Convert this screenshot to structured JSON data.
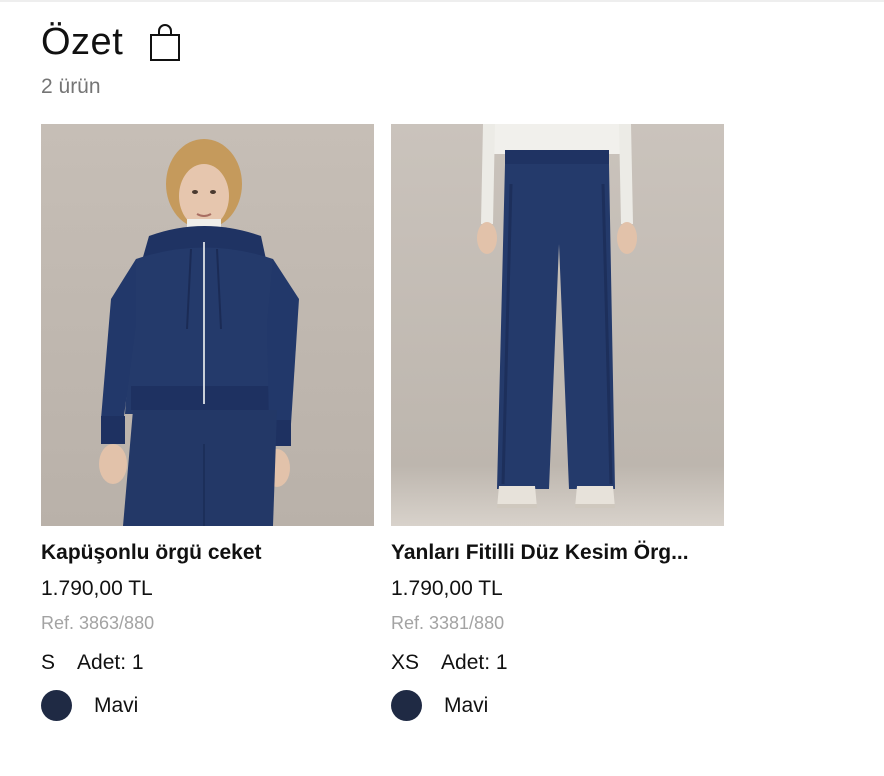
{
  "summary": {
    "title": "Özet",
    "count_label": "2 ürün",
    "icon": "shopping-bag-icon"
  },
  "products": [
    {
      "image_alt": "Kapüşonlu örgü ceket",
      "name": "Kapüşonlu örgü ceket",
      "price": "1.790,00 TL",
      "ref": "Ref. 3863/880",
      "size": "S",
      "quantity": "Adet: 1",
      "color_name": "Mavi",
      "color_hex": "#1f2a44"
    },
    {
      "image_alt": "Yanları Fitilli Düz Kesim Örg...",
      "name": "Yanları Fitilli Düz Kesim Örg...",
      "price": "1.790,00 TL",
      "ref": "Ref. 3381/880",
      "size": "XS",
      "quantity": "Adet: 1",
      "color_name": "Mavi",
      "color_hex": "#1f2a44"
    }
  ],
  "colors": {
    "image_background": "#c9c2bb",
    "garment": "#243a6b"
  }
}
